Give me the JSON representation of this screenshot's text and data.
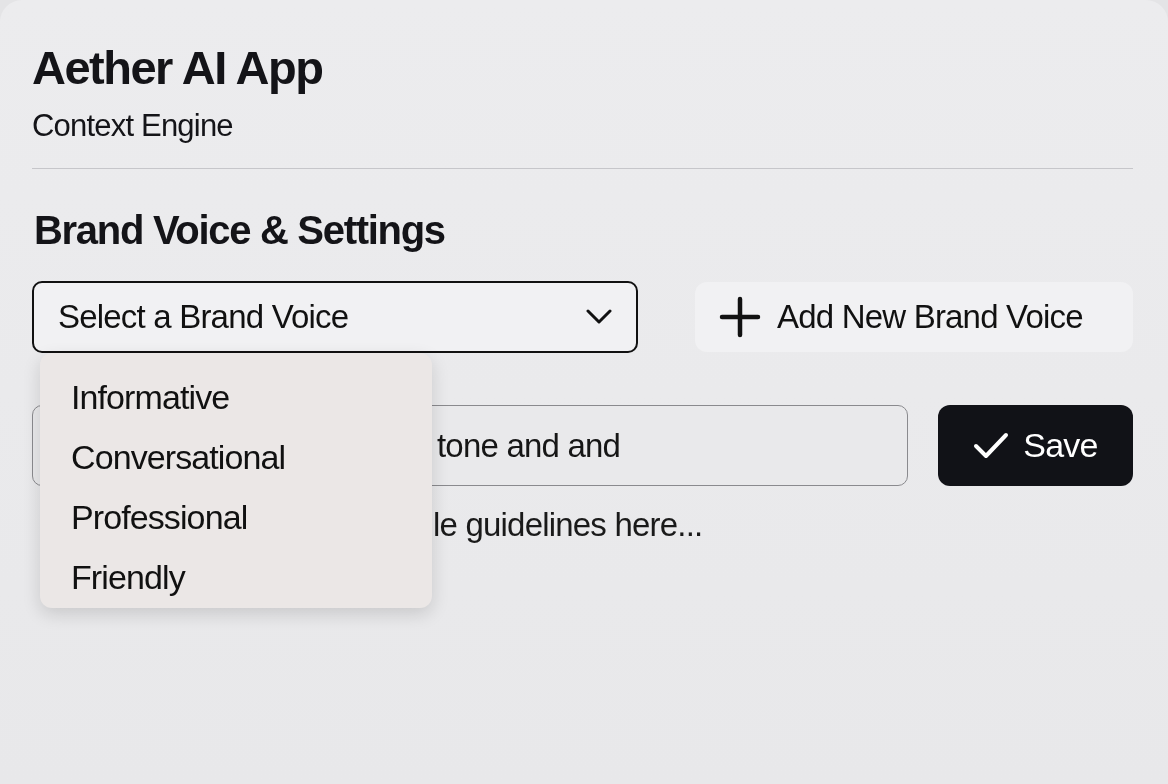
{
  "app": {
    "title": "Aether AI App",
    "subtitle": "Context Engine"
  },
  "section": {
    "heading": "Brand Voice & Settings"
  },
  "brand_select": {
    "placeholder": "Select a Brand Voice",
    "expanded": true,
    "options": [
      {
        "label": "Informative",
        "selected": false
      },
      {
        "label": "Conversational",
        "selected": false
      },
      {
        "label": "Professional",
        "selected": false
      },
      {
        "label": "Friendly",
        "selected": false
      }
    ]
  },
  "add_button": {
    "label": "Add New Brand Voice"
  },
  "guidelines_field": {
    "value": "tone and and"
  },
  "save_button": {
    "label": "Save"
  },
  "helper_text": "le guidelines here..."
}
